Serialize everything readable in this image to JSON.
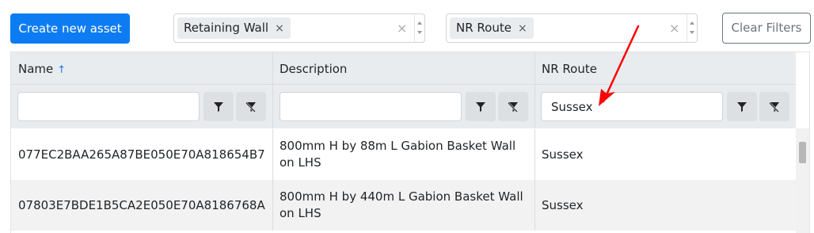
{
  "toolbar": {
    "create_label": "Create new asset",
    "clear_label": "Clear Filters"
  },
  "filter_asset_type": {
    "chip": "Retaining Wall",
    "remove": "×",
    "clear": "×"
  },
  "filter_route": {
    "chip": "NR Route",
    "remove": "×",
    "clear": "×"
  },
  "grid": {
    "columns": [
      {
        "title": "Name",
        "sort": "↑",
        "filter_value": ""
      },
      {
        "title": "Description",
        "filter_value": ""
      },
      {
        "title": "NR Route",
        "filter_value": "Sussex"
      }
    ],
    "rows": [
      {
        "name": "077EC2BAA265A87BE050E70A818654B7",
        "description": "800mm H by 88m L Gabion Basket Wall on LHS",
        "route": "Sussex"
      },
      {
        "name": "07803E7BDE1B5CA2E050E70A8186768A",
        "description": "800mm H by 440m L Gabion Basket Wall on LHS",
        "route": "Sussex"
      }
    ]
  },
  "colors": {
    "primary": "#0d7cf2",
    "annotation": "#ff0000",
    "header_bg": "#e9ecef"
  },
  "icons": [
    "filter-icon",
    "clear-filter-icon",
    "sort-asc-icon",
    "close-icon"
  ]
}
